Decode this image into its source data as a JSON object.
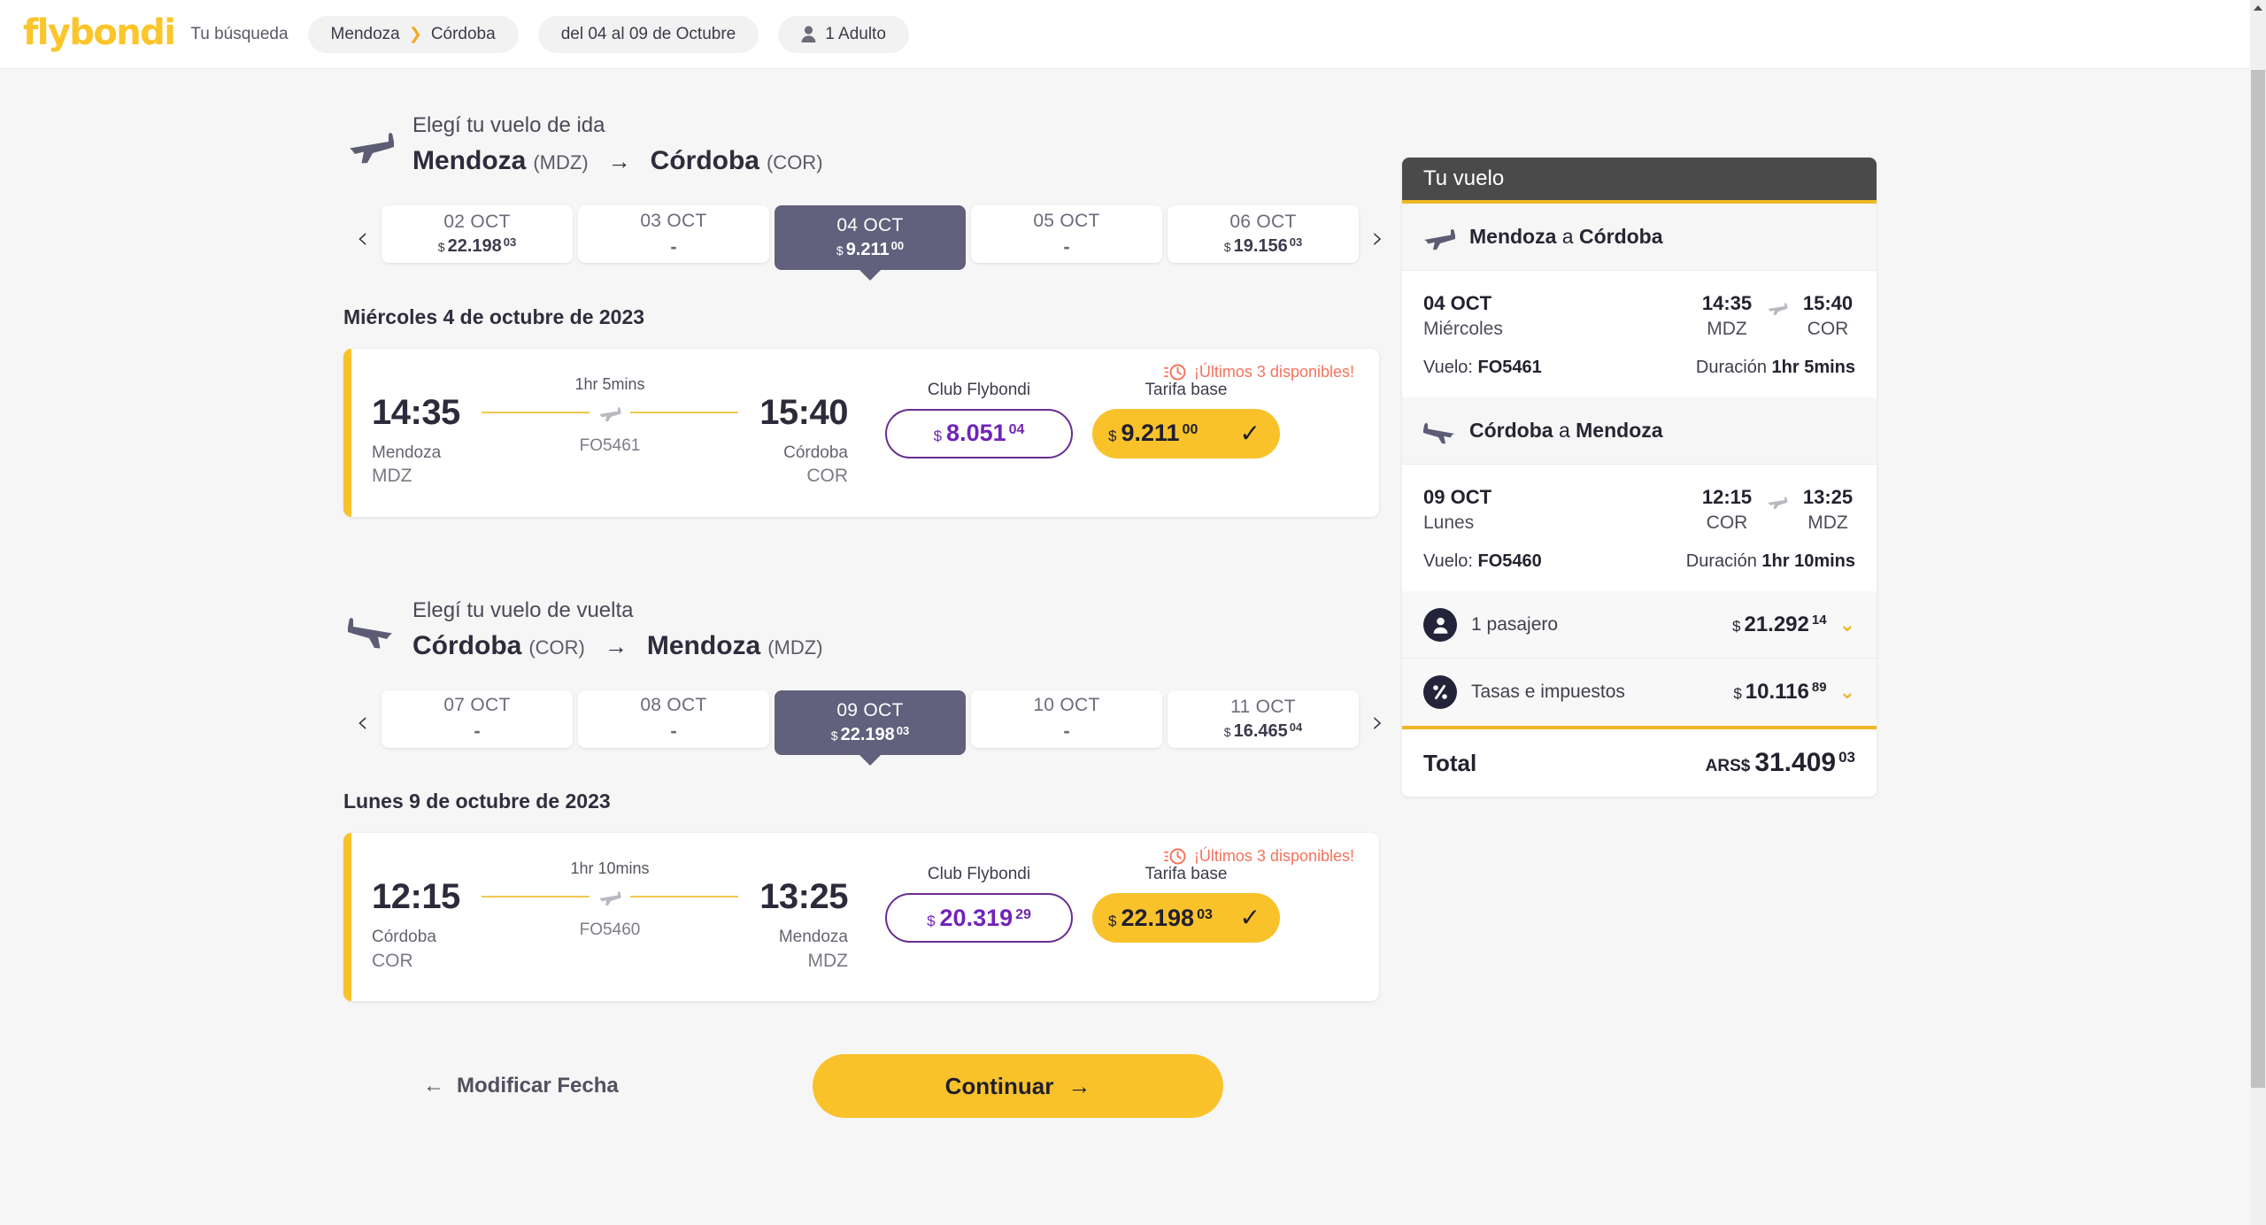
{
  "header": {
    "brand": "flybondi",
    "search_label": "Tu búsqueda",
    "route_chip": {
      "origin": "Mendoza",
      "destination": "Córdoba"
    },
    "dates_chip": "del 04 al 09 de Octubre",
    "pax_chip": "1 Adulto"
  },
  "outbound": {
    "kicker": "Elegí tu vuelo de ida",
    "origin_city": "Mendoza",
    "origin_code": "(MDZ)",
    "route_arrow": "→",
    "dest_city": "Córdoba",
    "dest_code": "(COR)",
    "prev_arrow": "‹",
    "next_arrow": "›",
    "dates": [
      {
        "day": "02 OCT",
        "currency": "$",
        "price": "22.198",
        "cents": "03",
        "selected": false
      },
      {
        "day": "03 OCT",
        "currency": "",
        "price": "-",
        "cents": "",
        "selected": false
      },
      {
        "day": "04 OCT",
        "currency": "$",
        "price": "9.211",
        "cents": "00",
        "selected": true
      },
      {
        "day": "05 OCT",
        "currency": "",
        "price": "-",
        "cents": "",
        "selected": false
      },
      {
        "day": "06 OCT",
        "currency": "$",
        "price": "19.156",
        "cents": "03",
        "selected": false
      }
    ],
    "day_title": "Miércoles 4 de octubre de 2023",
    "flight": {
      "availability": "¡Últimos 3 disponibles!",
      "depart_time": "14:35",
      "depart_city": "Mendoza",
      "depart_code": "MDZ",
      "duration": "1hr 5mins",
      "flight_number": "FO5461",
      "arrive_time": "15:40",
      "arrive_city": "Córdoba",
      "arrive_code": "COR",
      "club_label": "Club Flybondi",
      "club_currency": "$",
      "club_price": "8.051",
      "club_cents": "04",
      "base_label": "Tarifa base",
      "base_currency": "$",
      "base_price": "9.211",
      "base_cents": "00",
      "selected_check": "✓"
    }
  },
  "inbound": {
    "kicker": "Elegí tu vuelo de vuelta",
    "origin_city": "Córdoba",
    "origin_code": "(COR)",
    "route_arrow": "→",
    "dest_city": "Mendoza",
    "dest_code": "(MDZ)",
    "prev_arrow": "‹",
    "next_arrow": "›",
    "dates": [
      {
        "day": "07 OCT",
        "currency": "",
        "price": "-",
        "cents": "",
        "selected": false
      },
      {
        "day": "08 OCT",
        "currency": "",
        "price": "-",
        "cents": "",
        "selected": false
      },
      {
        "day": "09 OCT",
        "currency": "$",
        "price": "22.198",
        "cents": "03",
        "selected": true
      },
      {
        "day": "10 OCT",
        "currency": "",
        "price": "-",
        "cents": "",
        "selected": false
      },
      {
        "day": "11 OCT",
        "currency": "$",
        "price": "16.465",
        "cents": "04",
        "selected": false
      }
    ],
    "day_title": "Lunes 9 de octubre de 2023",
    "flight": {
      "availability": "¡Últimos 3 disponibles!",
      "depart_time": "12:15",
      "depart_city": "Córdoba",
      "depart_code": "COR",
      "duration": "1hr 10mins",
      "flight_number": "FO5460",
      "arrive_time": "13:25",
      "arrive_city": "Mendoza",
      "arrive_code": "MDZ",
      "club_label": "Club Flybondi",
      "club_currency": "$",
      "club_price": "20.319",
      "club_cents": "29",
      "base_label": "Tarifa base",
      "base_currency": "$",
      "base_price": "22.198",
      "base_cents": "03",
      "selected_check": "✓"
    }
  },
  "actions": {
    "back_arrow": "←",
    "back_label": "Modificar Fecha",
    "continue_label": "Continuar",
    "continue_arrow": "→"
  },
  "sidebar": {
    "title": "Tu vuelo",
    "legs": [
      {
        "from": "Mendoza",
        "connector": " a ",
        "to": "Córdoba",
        "date": "04 OCT",
        "weekday": "Miércoles",
        "depart_time": "14:35",
        "depart_code": "MDZ",
        "arrive_time": "15:40",
        "arrive_code": "COR",
        "flight_label": "Vuelo:",
        "flight_number": "FO5461",
        "duration_label": "Duración",
        "duration": "1hr 5mins"
      },
      {
        "from": "Córdoba",
        "connector": " a ",
        "to": "Mendoza",
        "date": "09 OCT",
        "weekday": "Lunes",
        "depart_time": "12:15",
        "depart_code": "COR",
        "arrive_time": "13:25",
        "arrive_code": "MDZ",
        "flight_label": "Vuelo:",
        "flight_number": "FO5460",
        "duration_label": "Duración",
        "duration": "1hr 10mins"
      }
    ],
    "passengers": {
      "label": "1 pasajero",
      "currency": "$",
      "amount": "21.292",
      "cents": "14",
      "chevron": "⌄"
    },
    "taxes": {
      "label": "Tasas e impuestos",
      "currency": "$",
      "amount": "10.116",
      "cents": "89",
      "chevron": "⌄"
    },
    "total": {
      "label": "Total",
      "currency": "ARS$",
      "amount": "31.409",
      "cents": "03"
    }
  },
  "colors": {
    "brand_yellow": "#f9c22b",
    "accent_yellow": "#f0b626",
    "selected_slate": "#61617d",
    "club_purple": "#7223b8",
    "alert_coral": "#f4725b",
    "dark_header": "#4a4a4a",
    "page_bg": "#f6f6f6"
  }
}
